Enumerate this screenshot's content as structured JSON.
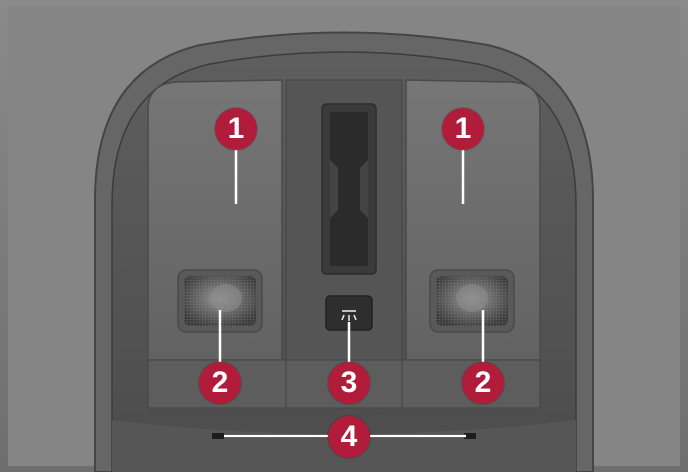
{
  "figure": {
    "description_free": true,
    "callouts": [
      {
        "id": "left-reading-light-zone",
        "label": "1"
      },
      {
        "id": "right-reading-light-zone",
        "label": "1"
      },
      {
        "id": "left-reading-lamp",
        "label": "2"
      },
      {
        "id": "right-reading-lamp",
        "label": "2"
      },
      {
        "id": "interior-light-button",
        "label": "3"
      },
      {
        "id": "ambient-light-strip",
        "label": "4"
      }
    ],
    "colors": {
      "callout": "#b01c3a",
      "headliner": "#7c7c7c",
      "console": "#5a5a5a",
      "panel": "#6a6a6a"
    }
  }
}
